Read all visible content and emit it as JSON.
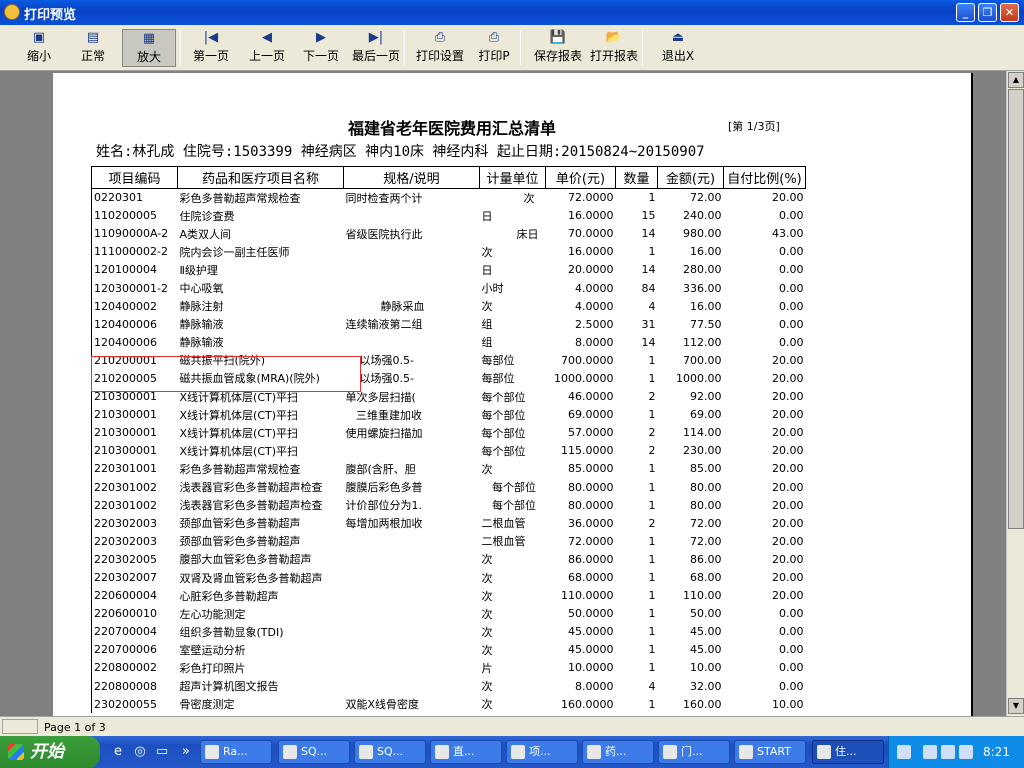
{
  "window": {
    "title": "打印预览"
  },
  "toolbar": [
    {
      "label": "缩小",
      "icon": "▣"
    },
    {
      "label": "正常",
      "icon": "▤"
    },
    {
      "label": "放大",
      "icon": "▦"
    },
    {
      "label": "第一页",
      "icon": "|◀"
    },
    {
      "label": "上一页",
      "icon": "◀"
    },
    {
      "label": "下一页",
      "icon": "▶"
    },
    {
      "label": "最后一页",
      "icon": "▶|"
    },
    {
      "label": "打印设置",
      "icon": "⎙"
    },
    {
      "label": "打印P",
      "icon": "⎙"
    },
    {
      "label": "保存报表",
      "icon": "💾"
    },
    {
      "label": "打开报表",
      "icon": "📂"
    },
    {
      "label": "退出X",
      "icon": "⏏"
    }
  ],
  "report": {
    "title": "福建省老年医院费用汇总清单",
    "page_label": "[第 1/3页]",
    "info_line": "姓名:林孔成  住院号:1503399  神经病区  神内10床     神经内科  起止日期:20150824~20150907",
    "columns": [
      "项目编码",
      "药品和医疗项目名称",
      "规格/说明",
      "计量单位",
      "单价(元)",
      "数量",
      "金额(元)",
      "自付比例(%)"
    ],
    "rows": [
      [
        "0220301",
        "彩色多普勒超声常规检查",
        "同时检查两个计",
        "            次",
        "72.0000",
        "1",
        "72.00",
        "20.00"
      ],
      [
        "110200005",
        "住院诊查费",
        "",
        "日",
        "16.0000",
        "15",
        "240.00",
        "0.00"
      ],
      [
        "11090000A-2",
        "A类双人间",
        "省级医院执行此",
        "          床日",
        "70.0000",
        "14",
        "980.00",
        "43.00"
      ],
      [
        "111000002-2",
        "院内会诊一副主任医师",
        "",
        "次",
        "16.0000",
        "1",
        "16.00",
        "0.00"
      ],
      [
        "120100004",
        "Ⅱ级护理",
        "",
        "日",
        "20.0000",
        "14",
        "280.00",
        "0.00"
      ],
      [
        "120300001-2",
        "中心吸氧",
        "",
        "小时",
        "4.0000",
        "84",
        "336.00",
        "0.00"
      ],
      [
        "120400002",
        "静脉注射",
        "          静脉采血",
        "次",
        "4.0000",
        "4",
        "16.00",
        "0.00"
      ],
      [
        "120400006",
        "静脉输液",
        "连续输液第二组",
        "组",
        "2.5000",
        "31",
        "77.50",
        "0.00"
      ],
      [
        "120400006",
        "静脉输液",
        "",
        "组",
        "8.0000",
        "14",
        "112.00",
        "0.00"
      ],
      [
        "210200001",
        "磁共振平扫(院外)",
        "    以场强0.5-",
        "每部位",
        "700.0000",
        "1",
        "700.00",
        "20.00"
      ],
      [
        "210200005",
        "磁共振血管成象(MRA)(院外)",
        "    以场强0.5-",
        "每部位",
        "1000.0000",
        "1",
        "1000.00",
        "20.00"
      ],
      [
        "210300001",
        "X线计算机体层(CT)平扫",
        "单次多层扫描(",
        "每个部位",
        "46.0000",
        "2",
        "92.00",
        "20.00"
      ],
      [
        "210300001",
        "X线计算机体层(CT)平扫",
        "   三维重建加收",
        "每个部位",
        "69.0000",
        "1",
        "69.00",
        "20.00"
      ],
      [
        "210300001",
        "X线计算机体层(CT)平扫",
        "使用螺旋扫描加",
        "每个部位",
        "57.0000",
        "2",
        "114.00",
        "20.00"
      ],
      [
        "210300001",
        "X线计算机体层(CT)平扫",
        "",
        "每个部位",
        "115.0000",
        "2",
        "230.00",
        "20.00"
      ],
      [
        "220301001",
        "彩色多普勒超声常规检查",
        "腹部(含肝、胆",
        "次",
        "85.0000",
        "1",
        "85.00",
        "20.00"
      ],
      [
        "220301002",
        "浅表器官彩色多普勒超声检查",
        "腹膜后彩色多普",
        "   每个部位",
        "80.0000",
        "1",
        "80.00",
        "20.00"
      ],
      [
        "220301002",
        "浅表器官彩色多普勒超声检查",
        "计价部位分为1.",
        "   每个部位",
        "80.0000",
        "1",
        "80.00",
        "20.00"
      ],
      [
        "220302003",
        "颈部血管彩色多普勒超声",
        "每增加两根加收",
        "二根血管",
        "36.0000",
        "2",
        "72.00",
        "20.00"
      ],
      [
        "220302003",
        "颈部血管彩色多普勒超声",
        "",
        "二根血管",
        "72.0000",
        "1",
        "72.00",
        "20.00"
      ],
      [
        "220302005",
        "腹部大血管彩色多普勒超声",
        "",
        "次",
        "86.0000",
        "1",
        "86.00",
        "20.00"
      ],
      [
        "220302007",
        "双肾及肾血管彩色多普勒超声",
        "",
        "次",
        "68.0000",
        "1",
        "68.00",
        "20.00"
      ],
      [
        "220600004",
        "心脏彩色多普勒超声",
        "",
        "次",
        "110.0000",
        "1",
        "110.00",
        "20.00"
      ],
      [
        "220600010",
        "左心功能测定",
        "",
        "次",
        "50.0000",
        "1",
        "50.00",
        "0.00"
      ],
      [
        "220700004",
        "组织多普勒显象(TDI)",
        "",
        "次",
        "45.0000",
        "1",
        "45.00",
        "0.00"
      ],
      [
        "220700006",
        "室壁运动分析",
        "",
        "次",
        "45.0000",
        "1",
        "45.00",
        "0.00"
      ],
      [
        "220800002",
        "彩色打印照片",
        "",
        "片",
        "10.0000",
        "1",
        "10.00",
        "0.00"
      ],
      [
        "220800008",
        "超声计算机图文报告",
        "",
        "次",
        "8.0000",
        "4",
        "32.00",
        "0.00"
      ],
      [
        "230200055",
        "骨密度测定",
        "双能X线骨密度",
        "次",
        "160.0000",
        "1",
        "160.00",
        "10.00"
      ]
    ]
  },
  "statusbar": {
    "page_text": "Page 1 of 3"
  },
  "taskbar": {
    "start_label": "开始",
    "tasks": [
      "Ra...",
      "SQ...",
      "SQ...",
      "直...",
      "项...",
      "药...",
      "门...",
      "START",
      "住..."
    ],
    "clock": "8:21"
  }
}
